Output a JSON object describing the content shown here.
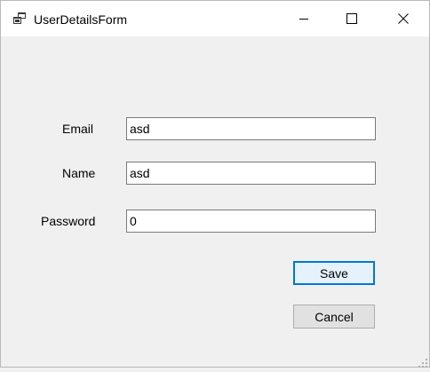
{
  "window": {
    "title": "UserDetailsForm"
  },
  "icons": {
    "app": "app-window-icon",
    "minimize": "minimize-icon",
    "maximize": "maximize-icon",
    "close": "close-icon"
  },
  "form": {
    "email_label": "Email",
    "email_value": "asd",
    "name_label": "Name",
    "name_value": "asd",
    "password_label": "Password",
    "password_value": "0"
  },
  "buttons": {
    "save_label": "Save",
    "cancel_label": "Cancel"
  },
  "colors": {
    "accent": "#0078d7",
    "window_bg": "#f0f0f0",
    "titlebar_bg": "#ffffff",
    "button_bg": "#e1e1e1"
  }
}
